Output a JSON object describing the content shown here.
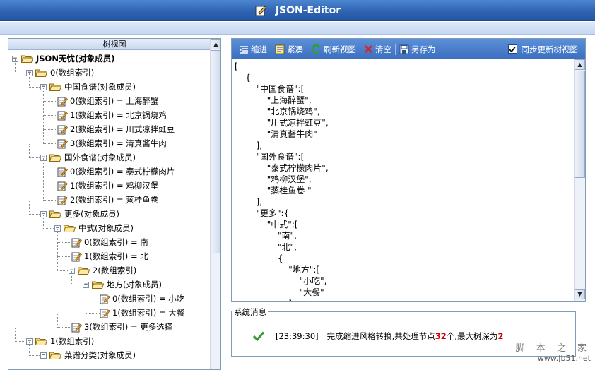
{
  "app": {
    "title": "JSON-Editor"
  },
  "tree": {
    "header": "树视图",
    "nodes": [
      {
        "label": "JSON无忧(对象成员)",
        "bold": true
      },
      {
        "label": "0(数组索引)"
      },
      {
        "label": "中国食谱(对象成员)"
      },
      {
        "label": "0(数组索引) = 上海醉蟹"
      },
      {
        "label": "1(数组索引) = 北京锅烧鸡"
      },
      {
        "label": "2(数组索引) = 川式凉拌豇豆"
      },
      {
        "label": "3(数组索引) = 清真酱牛肉"
      },
      {
        "label": "国外食谱(对象成员)"
      },
      {
        "label": "0(数组索引) = 泰式柠檬肉片"
      },
      {
        "label": "1(数组索引) = 鸡柳汉堡"
      },
      {
        "label": "2(数组索引) = 蒸桂鱼卷"
      },
      {
        "label": "更多(对象成员)"
      },
      {
        "label": "中式(对象成员)"
      },
      {
        "label": "0(数组索引) = 南"
      },
      {
        "label": "1(数组索引) = 北"
      },
      {
        "label": "2(数组索引)"
      },
      {
        "label": "地方(对象成员)"
      },
      {
        "label": "0(数组索引) = 小吃"
      },
      {
        "label": "1(数组索引) = 大餐"
      },
      {
        "label": "3(数组索引) = 更多选择"
      },
      {
        "label": "1(数组索引)"
      },
      {
        "label": "菜谱分类(对象成员)"
      }
    ]
  },
  "toolbar": {
    "indent": "缩进",
    "compact": "紧凑",
    "refresh": "刷新视图",
    "clear": "清空",
    "save_as": "另存为",
    "sync_label": "同步更新树视图",
    "sync_checked": true
  },
  "editor": {
    "lines": [
      "[",
      "    {",
      "        \"中国食谱\":[",
      "            \"上海醉蟹\",",
      "            \"北京锅烧鸡\",",
      "            \"川式凉拌豇豆\",",
      "            \"清真酱牛肉\"",
      "        ],",
      "        \"国外食谱\":[",
      "            \"泰式柠檬肉片\",",
      "            \"鸡柳汉堡\",",
      "            \"蒸桂鱼卷 \"",
      "        ],",
      "        \"更多\":{",
      "            \"中式\":[",
      "                \"南\",",
      "                \"北\",",
      "                {",
      "                    \"地方\":[",
      "                        \"小吃\",",
      "                        \"大餐\"",
      "                    ]"
    ]
  },
  "messages": {
    "title": "系统消息",
    "time": "[23:39:30]",
    "text_a": "完成缩进风格转换,共处理节点",
    "nodes": "32",
    "text_b": "个,最大树深为",
    "depth": "2"
  },
  "watermark": {
    "line1": "脚 本 之 家",
    "line2": "www.Jb51.net"
  }
}
